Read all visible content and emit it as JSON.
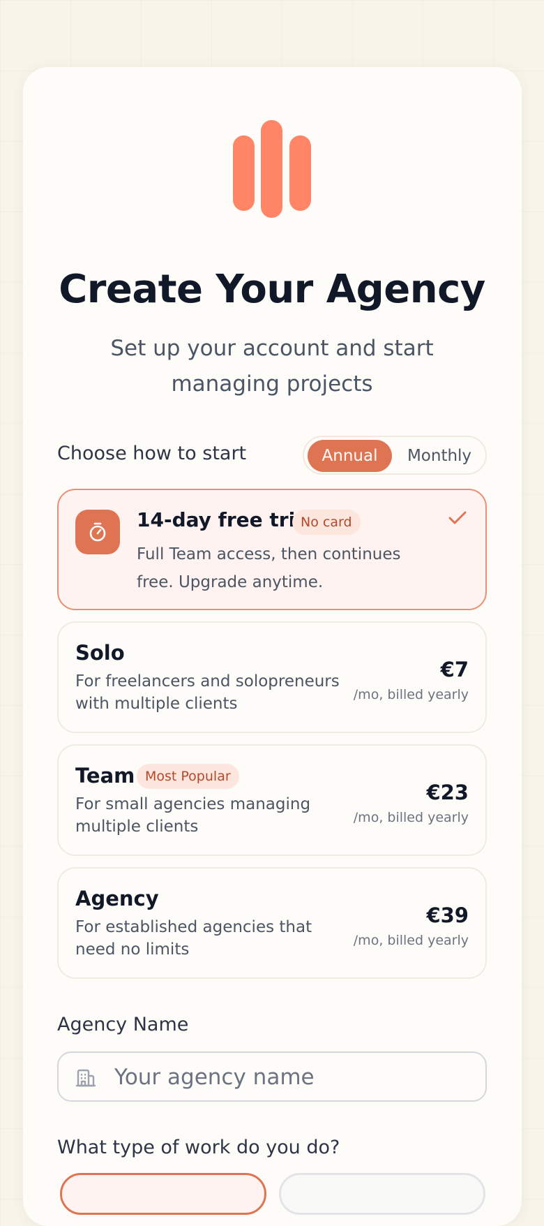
{
  "header": {
    "title": "Create Your Agency",
    "subtitle": "Set up your account and start managing projects"
  },
  "billing": {
    "label": "Choose how to start",
    "options": [
      "Annual",
      "Monthly"
    ],
    "selected": "Annual"
  },
  "trial": {
    "title": "14-day free trial",
    "badge": "No card",
    "description": "Full Team access, then continues free. Upgrade anytime.",
    "selected": true,
    "icon": "stopwatch-icon"
  },
  "plans": [
    {
      "name": "Solo",
      "badge": "",
      "description": "For freelancers and solopreneurs with multiple clients",
      "price": "€7",
      "billing": "/mo, billed yearly"
    },
    {
      "name": "Team",
      "badge": "Most Popular",
      "description": "For small agencies managing multiple clients",
      "price": "€23",
      "billing": "/mo, billed yearly"
    },
    {
      "name": "Agency",
      "badge": "",
      "description": "For established agencies that need no limits",
      "price": "€39",
      "billing": "/mo, billed yearly"
    }
  ],
  "form": {
    "agency_name_label": "Agency Name",
    "agency_name_placeholder": "Your agency name",
    "agency_name_value": "",
    "work_type_label": "What type of work do you do?"
  },
  "colors": {
    "accent": "#df7452",
    "logo": "#ff8566",
    "badge_bg": "#fde6de",
    "badge_text": "#b5482a",
    "heading": "#111827",
    "body_text": "#4b5563"
  }
}
